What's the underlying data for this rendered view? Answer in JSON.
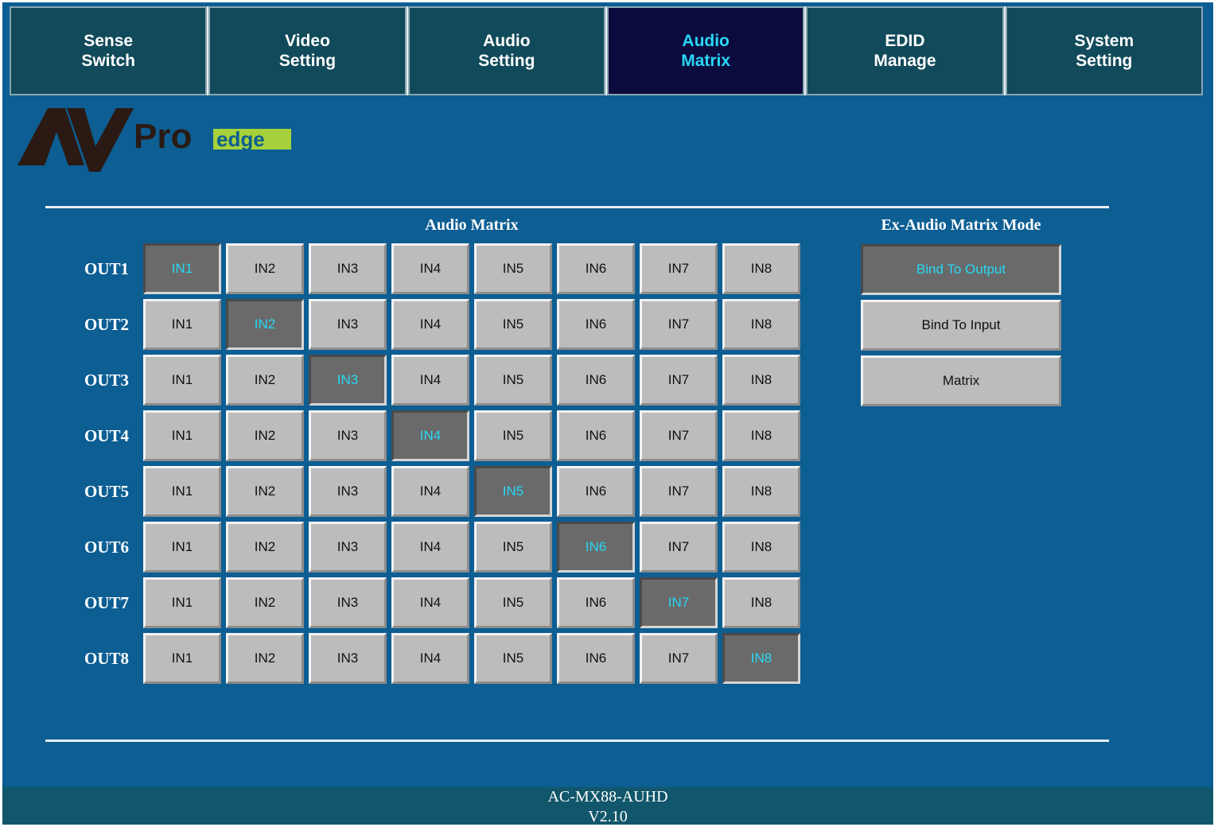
{
  "nav": {
    "tabs": [
      {
        "line1": "Sense",
        "line2": "Switch",
        "active": false
      },
      {
        "line1": "Video",
        "line2": "Setting",
        "active": false
      },
      {
        "line1": "Audio",
        "line2": "Setting",
        "active": false
      },
      {
        "line1": "Audio",
        "line2": "Matrix",
        "active": true
      },
      {
        "line1": "EDID",
        "line2": "Manage",
        "active": false
      },
      {
        "line1": "System",
        "line2": "Setting",
        "active": false
      }
    ]
  },
  "logo": {
    "av": "AV",
    "pro": "Pro",
    "edge": "edge"
  },
  "matrix": {
    "title": "Audio Matrix",
    "outputs": [
      "OUT1",
      "OUT2",
      "OUT3",
      "OUT4",
      "OUT5",
      "OUT6",
      "OUT7",
      "OUT8"
    ],
    "inputs": [
      "IN1",
      "IN2",
      "IN3",
      "IN4",
      "IN5",
      "IN6",
      "IN7",
      "IN8"
    ],
    "selected": [
      0,
      1,
      2,
      3,
      4,
      5,
      6,
      7
    ]
  },
  "ex_audio": {
    "title": "Ex-Audio Matrix Mode",
    "buttons": [
      {
        "label": "Bind To Output",
        "selected": true
      },
      {
        "label": "Bind To Input",
        "selected": false
      },
      {
        "label": "Matrix",
        "selected": false
      }
    ]
  },
  "footer": {
    "model": "AC-MX88-AUHD",
    "version": "V2.10"
  },
  "colors": {
    "background": "#0c5e93",
    "nav_tab": "#114a5a",
    "nav_active": "#0c0b3e",
    "accent_cyan": "#27d8f4",
    "button_gray": "#bcbcbc",
    "selected_gray": "#6a6a6a",
    "logo_green": "#a6d13a"
  }
}
